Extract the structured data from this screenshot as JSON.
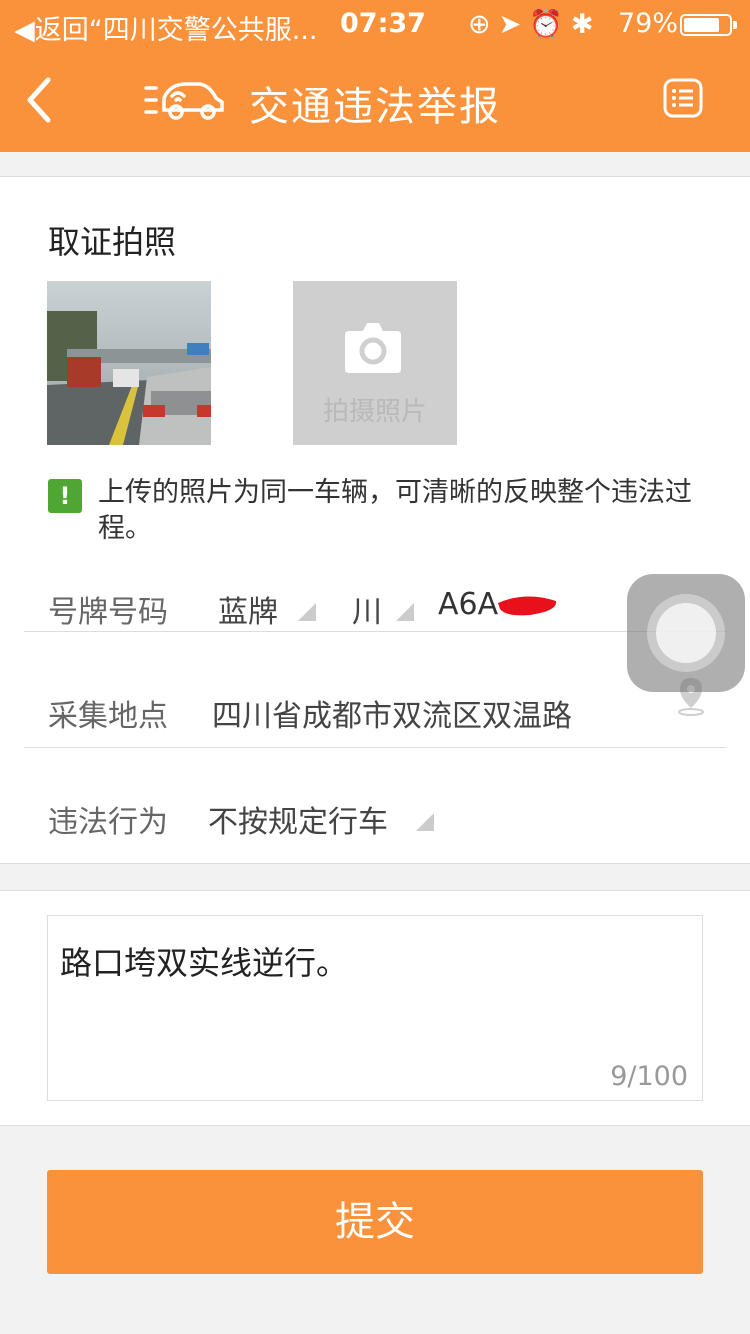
{
  "status_bar": {
    "back_app": "◀返回“四川交警公共服...",
    "time": "07:37",
    "battery": "79%",
    "battery_level": 0.79
  },
  "nav": {
    "title": "交通违法举报"
  },
  "evidence": {
    "title": "取证拍照",
    "add_photo_label": "拍摄照片",
    "notice": "上传的照片为同一车辆，可清晰的反映整个违法过程。"
  },
  "plate": {
    "label": "号牌号码",
    "color": "蓝牌",
    "province": "川",
    "number": "A6A"
  },
  "location": {
    "label": "采集地点",
    "value": "四川省成都市双流区双温路"
  },
  "violation": {
    "label": "违法行为",
    "value": "不按规定行车"
  },
  "description": {
    "text": "路口垮双实线逆行。",
    "counter": "9/100"
  },
  "submit_label": "提交",
  "colors": {
    "accent": "#f9923b",
    "notice_icon": "#50a633"
  }
}
